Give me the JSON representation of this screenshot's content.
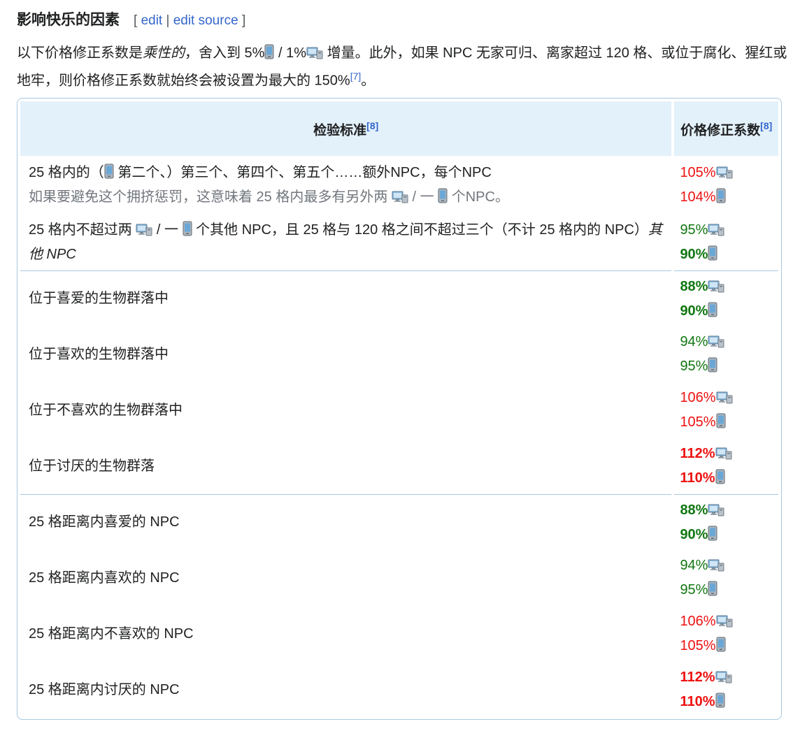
{
  "heading": {
    "title": "影响快乐的因素",
    "edit_open": "[",
    "edit": "edit",
    "edit_sep": "|",
    "edit_source": "edit source",
    "edit_close": "]"
  },
  "intro": {
    "t1": "以下价格修正系数是",
    "t2_em": "乘性的",
    "t3": "，舍入到 5%",
    "t4": " / 1%",
    "t5": " 增量。此外，如果 NPC 无家可归、离家超过 120 格、或位于腐化、猩红或地牢，则价格修正系数就始终会被设置为最大的 150%",
    "ref": "[7]",
    "t6": "。"
  },
  "table": {
    "header_criterion": "检验标准",
    "header_criterion_ref": "[8]",
    "header_modifier": "价格修正系数",
    "header_modifier_ref": "[8]",
    "crowd": {
      "t1": "25 格内的（",
      "t2": " 第二个、）第三个、第四个、第五个……额外NPC，每个NPC",
      "sub1": "如果要避免这个拥挤惩罚，这意味着 25 格内最多有另外两 ",
      "sub2": " / 一 ",
      "sub3": " 个NPC。",
      "v1": "105%",
      "v2": "104%"
    },
    "solitude": {
      "t1": "25 格内不超过两 ",
      "t2": " / 一 ",
      "t3": " 个其他 NPC，且 25 格与 120 格之间不超过三个（不计 25 格内的 NPC）",
      "t4_em": "其他 NPC",
      "v1": "95%",
      "v2": "90%"
    },
    "rows": [
      {
        "label": "位于喜爱的生物群落中",
        "v1": "88%",
        "v2": "90%"
      },
      {
        "label": "位于喜欢的生物群落中",
        "v1": "94%",
        "v2": "95%"
      },
      {
        "label": "位于不喜欢的生物群落中",
        "v1": "106%",
        "v2": "105%"
      },
      {
        "label": "位于讨厌的生物群落",
        "v1": "112%",
        "v2": "110%"
      },
      {
        "label": "25 格距离内喜爱的 NPC",
        "v1": "88%",
        "v2": "90%"
      },
      {
        "label": "25 格距离内喜欢的 NPC",
        "v1": "94%",
        "v2": "95%"
      },
      {
        "label": "25 格距离内不喜欢的 NPC",
        "v1": "106%",
        "v2": "105%"
      },
      {
        "label": "25 格距离内讨厌的 NPC",
        "v1": "112%",
        "v2": "110%"
      }
    ]
  },
  "icons": {
    "desktop": "desktop-version-icon",
    "mobile": "mobile-version-icon"
  },
  "colors": {
    "penalty": "#ee1111",
    "bonus": "#117711",
    "link": "#3366cc",
    "header_bg": "#e3f1fb",
    "border": "#a7c8e0"
  }
}
